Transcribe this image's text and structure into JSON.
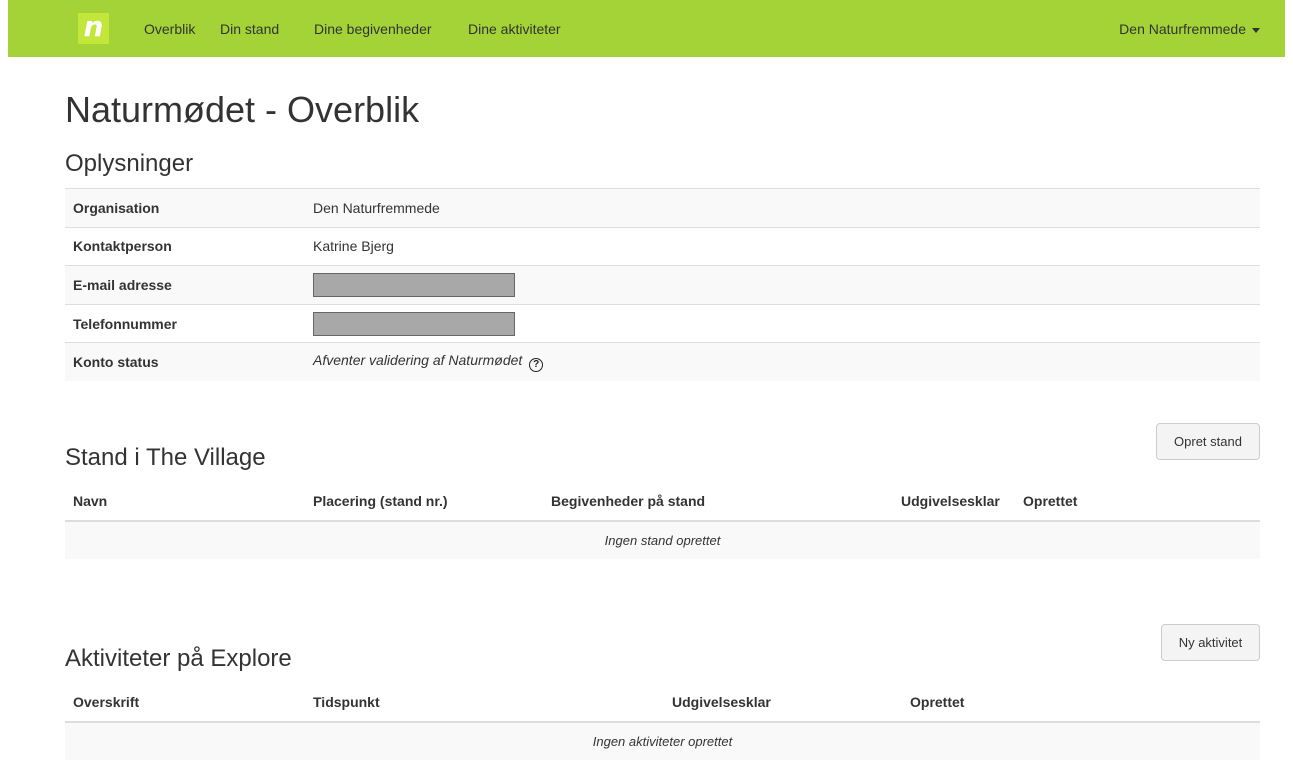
{
  "navbar": {
    "logo_letter": "n",
    "links": [
      "Overblik",
      "Din stand",
      "Dine begivenheder",
      "Dine aktiviteter"
    ],
    "user_menu": "Den Naturfremmede"
  },
  "page_title": "Naturmødet - Overblik",
  "info": {
    "heading": "Oplysninger",
    "rows": [
      {
        "label": "Organisation",
        "value": "Den Naturfremmede"
      },
      {
        "label": "Kontaktperson",
        "value": "Katrine Bjerg"
      },
      {
        "label": "E-mail adresse",
        "value": ""
      },
      {
        "label": "Telefonnummer",
        "value": ""
      },
      {
        "label": "Konto status",
        "value": "Afventer validering af Naturmødet"
      }
    ],
    "help_glyph": "?"
  },
  "stand": {
    "heading": "Stand i The Village",
    "button": "Opret stand",
    "columns": [
      "Navn",
      "Placering (stand nr.)",
      "Begivenheder på stand",
      "Udgivelsesklar",
      "Oprettet"
    ],
    "empty": "Ingen stand oprettet"
  },
  "activities": {
    "heading": "Aktiviteter på Explore",
    "button": "Ny aktivitet",
    "columns": [
      "Overskrift",
      "Tidspunkt",
      "Udgivelsesklar",
      "Oprettet"
    ],
    "empty": "Ingen aktiviteter oprettet"
  },
  "colors": {
    "navbar": "#a3d336",
    "logo": "#c3e63a",
    "stripe": "#f9f9f9"
  },
  "icons": [
    "help-circle-icon",
    "caret-down-icon"
  ]
}
